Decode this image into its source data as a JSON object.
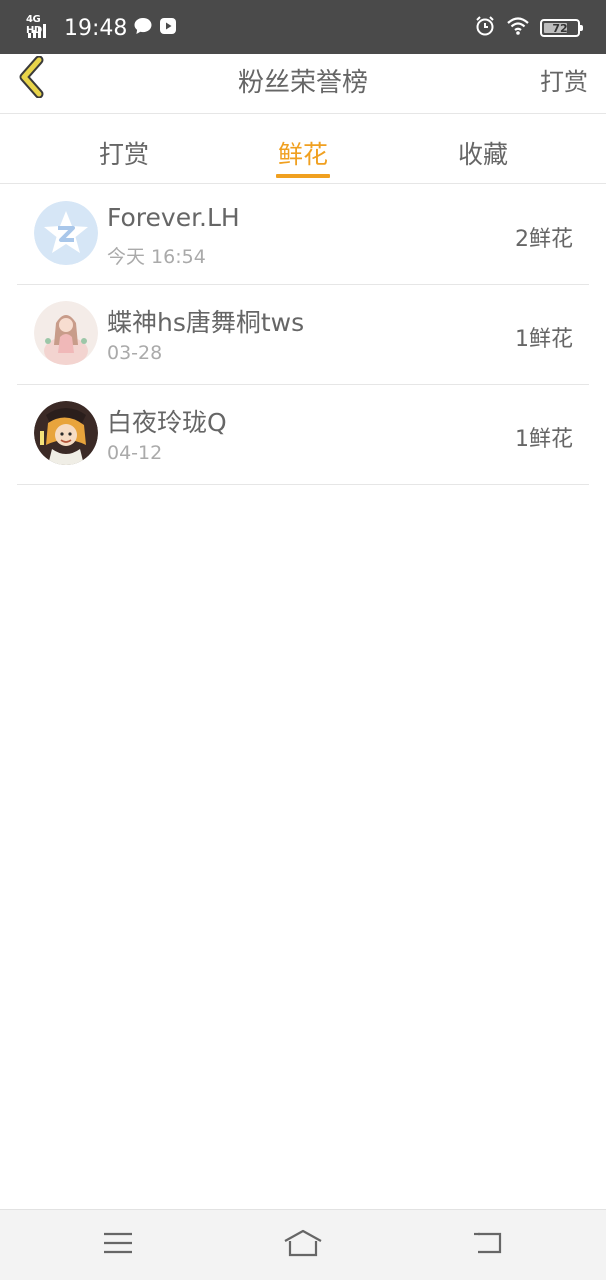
{
  "status_bar": {
    "network": "4G HD",
    "time": "19:48",
    "battery": "72",
    "battery_level": 0.72,
    "icons": [
      "chat-bubble-icon",
      "video-play-icon",
      "alarm-clock-icon",
      "wifi-icon",
      "battery-icon"
    ]
  },
  "nav": {
    "title": "粉丝荣誉榜",
    "action_label": "打赏",
    "back_icon": "chevron-left-icon"
  },
  "tabs": [
    {
      "label": "打赏",
      "active": false
    },
    {
      "label": "鲜花",
      "active": true
    },
    {
      "label": "收藏",
      "active": false
    }
  ],
  "list": [
    {
      "name": "Forever.LH",
      "date": "今天 16:54",
      "count": "2鲜花",
      "avatar": "qq-default-avatar"
    },
    {
      "name": "蝶神hs唐舞桐tws",
      "date": "03-28",
      "count": "1鲜花",
      "avatar": "anime-girl-avatar"
    },
    {
      "name": "白夜玲珑Q",
      "date": "04-12",
      "count": "1鲜花",
      "avatar": "anime-character-avatar"
    }
  ],
  "colors": {
    "accent": "#f0a020",
    "status_bar": "#4a4a4a",
    "back_chevron": "#e8d44a",
    "text": "#666666",
    "subtext": "#aaaaaa"
  },
  "system_nav": {
    "icons": [
      "menu-icon",
      "home-icon",
      "back-icon"
    ]
  }
}
